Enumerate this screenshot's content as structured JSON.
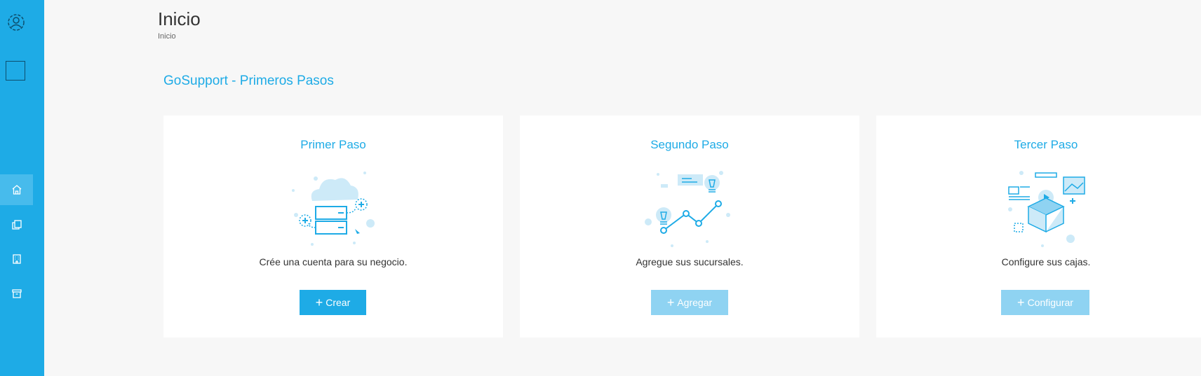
{
  "header": {
    "title": "Inicio",
    "breadcrumb": "Inicio"
  },
  "section": {
    "title": "GoSupport - Primeros Pasos"
  },
  "sidebar": {
    "items": [
      {
        "icon": "home-icon",
        "active": true
      },
      {
        "icon": "copy-icon",
        "active": false
      },
      {
        "icon": "building-icon",
        "active": false
      },
      {
        "icon": "archive-icon",
        "active": false
      }
    ]
  },
  "steps": [
    {
      "title": "Primer Paso",
      "description": "Crée una cuenta para su negocio.",
      "button": "Crear",
      "enabled": true,
      "illustration": "cloud-server-illustration"
    },
    {
      "title": "Segundo Paso",
      "description": "Agregue sus sucursales.",
      "button": "Agregar",
      "enabled": false,
      "illustration": "growth-chart-illustration"
    },
    {
      "title": "Tercer Paso",
      "description": "Configure sus cajas.",
      "button": "Configurar",
      "enabled": false,
      "illustration": "open-box-illustration"
    }
  ],
  "colors": {
    "accent": "#1eabe6",
    "accent_light": "#8fd3f2",
    "sidebar_active": "#47bbec",
    "background": "#f7f7f7"
  }
}
